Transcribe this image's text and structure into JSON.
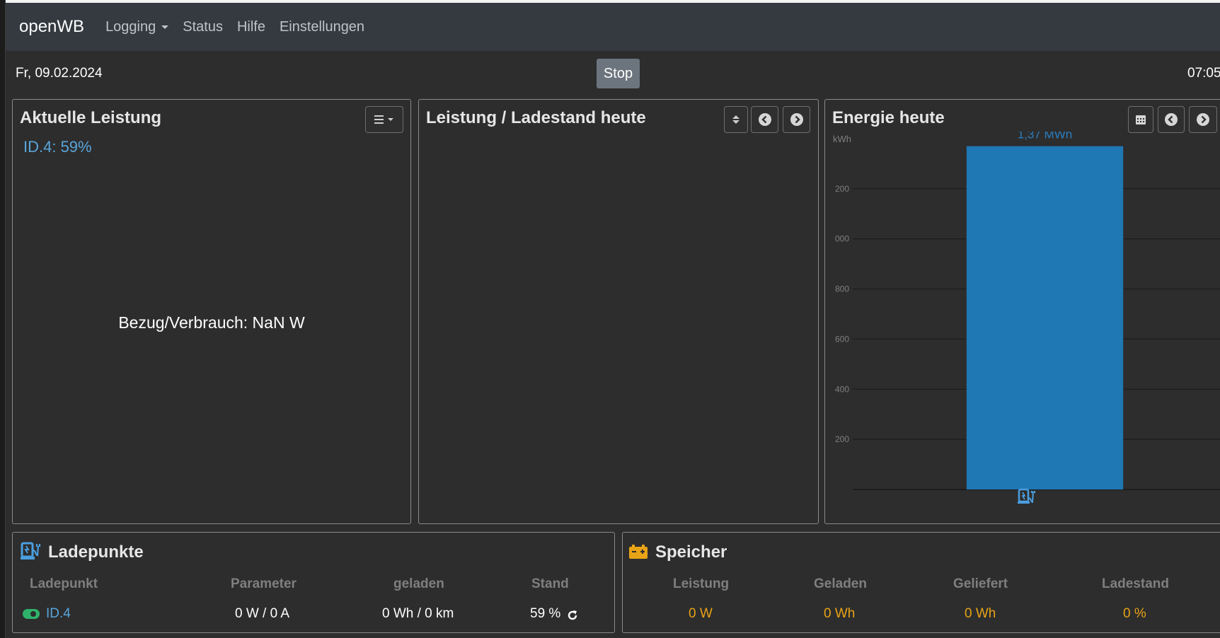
{
  "navbar": {
    "brand": "openWB",
    "items": [
      {
        "label": "Logging",
        "dropdown": true
      },
      {
        "label": "Status"
      },
      {
        "label": "Hilfe"
      },
      {
        "label": "Einstellungen"
      }
    ]
  },
  "header": {
    "date": "Fr, 09.02.2024",
    "time": "07:05",
    "stop_label": "Stop"
  },
  "card_power": {
    "title": "Aktuelle Leistung",
    "soc_label": "ID.4: 59%",
    "center_text": "Bezug/Verbrauch: NaN W"
  },
  "card_chart": {
    "title": "Leistung / Ladestand heute"
  },
  "card_energy": {
    "title": "Energie heute",
    "unit": "kWh",
    "bar_label": "1,37 MWh"
  },
  "chart_data": {
    "type": "bar",
    "categories": [
      "Ladepunkt"
    ],
    "values": [
      1370
    ],
    "bar_label": "1,37 MWh",
    "ylabel": "kWh",
    "ytick_labels": [
      "200",
      "400",
      "600",
      "800",
      "000",
      "200"
    ],
    "ytick_values": [
      200,
      400,
      600,
      800,
      1000,
      1200
    ],
    "ylim": [
      0,
      1400
    ],
    "grid": true,
    "color": "#1f77b4"
  },
  "ladepunkte": {
    "title": "Ladepunkte",
    "headers": [
      "Ladepunkt",
      "Parameter",
      "geladen",
      "Stand"
    ],
    "rows": [
      {
        "name": "ID.4",
        "parameter": "0 W / 0 A",
        "geladen": "0 Wh / 0 km",
        "stand": "59 %"
      }
    ]
  },
  "speicher": {
    "title": "Speicher",
    "headers": [
      "Leistung",
      "Geladen",
      "Geliefert",
      "Ladestand"
    ],
    "values": [
      "0 W",
      "0 Wh",
      "0 Wh",
      "0 %"
    ]
  },
  "colors": {
    "accent_blue": "#58a6dc",
    "bar_blue": "#1f77b4",
    "speicher_orange": "#e8a317",
    "toggle_green": "#2fb36b"
  }
}
